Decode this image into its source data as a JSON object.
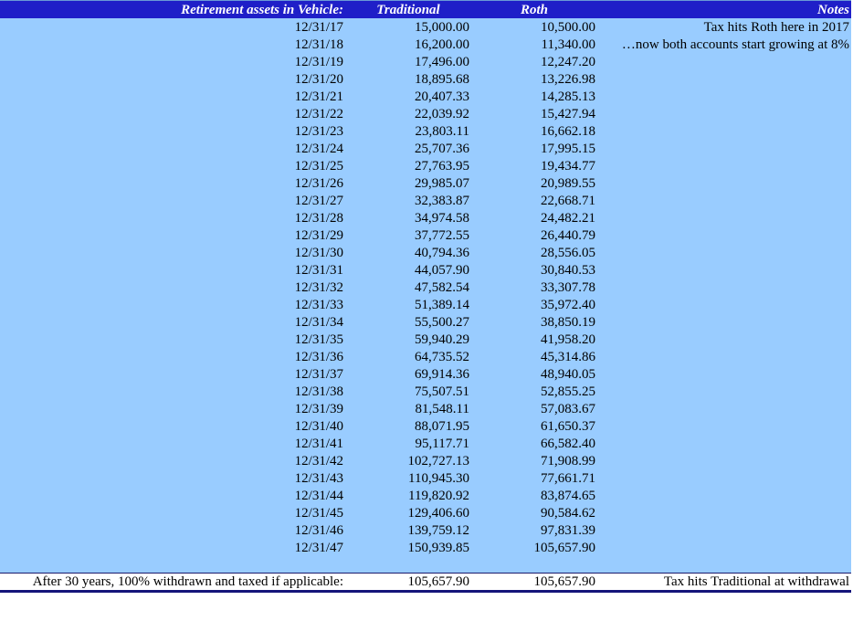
{
  "header": {
    "label": "Retirement assets in Vehicle:",
    "traditional": "Traditional",
    "roth": "Roth",
    "notes": "Notes"
  },
  "rows": [
    {
      "date": "12/31/17",
      "traditional": "15,000.00",
      "roth": "10,500.00",
      "note": "Tax hits Roth here in 2017"
    },
    {
      "date": "12/31/18",
      "traditional": "16,200.00",
      "roth": "11,340.00",
      "note": "…now both accounts start growing at 8%"
    },
    {
      "date": "12/31/19",
      "traditional": "17,496.00",
      "roth": "12,247.20",
      "note": ""
    },
    {
      "date": "12/31/20",
      "traditional": "18,895.68",
      "roth": "13,226.98",
      "note": ""
    },
    {
      "date": "12/31/21",
      "traditional": "20,407.33",
      "roth": "14,285.13",
      "note": ""
    },
    {
      "date": "12/31/22",
      "traditional": "22,039.92",
      "roth": "15,427.94",
      "note": ""
    },
    {
      "date": "12/31/23",
      "traditional": "23,803.11",
      "roth": "16,662.18",
      "note": ""
    },
    {
      "date": "12/31/24",
      "traditional": "25,707.36",
      "roth": "17,995.15",
      "note": ""
    },
    {
      "date": "12/31/25",
      "traditional": "27,763.95",
      "roth": "19,434.77",
      "note": ""
    },
    {
      "date": "12/31/26",
      "traditional": "29,985.07",
      "roth": "20,989.55",
      "note": ""
    },
    {
      "date": "12/31/27",
      "traditional": "32,383.87",
      "roth": "22,668.71",
      "note": ""
    },
    {
      "date": "12/31/28",
      "traditional": "34,974.58",
      "roth": "24,482.21",
      "note": ""
    },
    {
      "date": "12/31/29",
      "traditional": "37,772.55",
      "roth": "26,440.79",
      "note": ""
    },
    {
      "date": "12/31/30",
      "traditional": "40,794.36",
      "roth": "28,556.05",
      "note": ""
    },
    {
      "date": "12/31/31",
      "traditional": "44,057.90",
      "roth": "30,840.53",
      "note": ""
    },
    {
      "date": "12/31/32",
      "traditional": "47,582.54",
      "roth": "33,307.78",
      "note": ""
    },
    {
      "date": "12/31/33",
      "traditional": "51,389.14",
      "roth": "35,972.40",
      "note": ""
    },
    {
      "date": "12/31/34",
      "traditional": "55,500.27",
      "roth": "38,850.19",
      "note": ""
    },
    {
      "date": "12/31/35",
      "traditional": "59,940.29",
      "roth": "41,958.20",
      "note": ""
    },
    {
      "date": "12/31/36",
      "traditional": "64,735.52",
      "roth": "45,314.86",
      "note": ""
    },
    {
      "date": "12/31/37",
      "traditional": "69,914.36",
      "roth": "48,940.05",
      "note": ""
    },
    {
      "date": "12/31/38",
      "traditional": "75,507.51",
      "roth": "52,855.25",
      "note": ""
    },
    {
      "date": "12/31/39",
      "traditional": "81,548.11",
      "roth": "57,083.67",
      "note": ""
    },
    {
      "date": "12/31/40",
      "traditional": "88,071.95",
      "roth": "61,650.37",
      "note": ""
    },
    {
      "date": "12/31/41",
      "traditional": "95,117.71",
      "roth": "66,582.40",
      "note": ""
    },
    {
      "date": "12/31/42",
      "traditional": "102,727.13",
      "roth": "71,908.99",
      "note": ""
    },
    {
      "date": "12/31/43",
      "traditional": "110,945.30",
      "roth": "77,661.71",
      "note": ""
    },
    {
      "date": "12/31/44",
      "traditional": "119,820.92",
      "roth": "83,874.65",
      "note": ""
    },
    {
      "date": "12/31/45",
      "traditional": "129,406.60",
      "roth": "90,584.62",
      "note": ""
    },
    {
      "date": "12/31/46",
      "traditional": "139,759.12",
      "roth": "97,831.39",
      "note": ""
    },
    {
      "date": "12/31/47",
      "traditional": "150,939.85",
      "roth": "105,657.90",
      "note": ""
    }
  ],
  "summary": {
    "label": "After 30 years, 100% withdrawn and taxed if applicable:",
    "traditional": "105,657.90",
    "roth": "105,657.90",
    "note": "Tax hits Traditional at withdrawal"
  },
  "colors": {
    "header_bg": "#1f1fc8",
    "header_text": "#ffffff",
    "body_bg": "#99ccff",
    "summary_border": "#14147a"
  }
}
